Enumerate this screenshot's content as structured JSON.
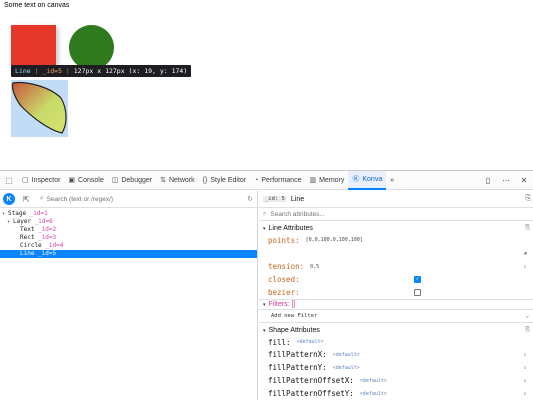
{
  "canvas": {
    "text": "Some text on canvas",
    "tooltip": {
      "name": "Line",
      "separator": "|",
      "id": "_id=5",
      "info": "127px x 127px (x: 19, y: 174)"
    }
  },
  "toolbar": {
    "tabs": [
      {
        "label": "Inspector",
        "icon": "inspector-icon"
      },
      {
        "label": "Console",
        "icon": "console-icon"
      },
      {
        "label": "Debugger",
        "icon": "debugger-icon"
      },
      {
        "label": "Network",
        "icon": "network-icon"
      },
      {
        "label": "Style Editor",
        "icon": "style-editor-icon"
      },
      {
        "label": "Performance",
        "icon": "performance-icon"
      },
      {
        "label": "Memory",
        "icon": "memory-icon"
      },
      {
        "label": "Konva",
        "icon": "konva-icon"
      }
    ],
    "active_tab": "Konva",
    "overflow": "»",
    "accent": "#0a84ff"
  },
  "tree": {
    "logo": "K",
    "search_placeholder": "Search (text or /regex/)",
    "nodes": [
      {
        "name": "Stage",
        "id": "_id=1",
        "depth": 0,
        "arrow": "▾"
      },
      {
        "name": "Layer",
        "id": "_id=6",
        "depth": 1,
        "arrow": "▾"
      },
      {
        "name": "Text",
        "id": "_id=2",
        "depth": 2,
        "arrow": ""
      },
      {
        "name": "Rect",
        "id": "_id=3",
        "depth": 2,
        "arrow": ""
      },
      {
        "name": "Circle",
        "id": "_id=4",
        "depth": 2,
        "arrow": ""
      },
      {
        "name": "Line",
        "id": "_id=5",
        "depth": 2,
        "arrow": ""
      }
    ],
    "selected": "Line"
  },
  "attributes": {
    "node_badge": "_id: 5",
    "node_name": "Line",
    "search_placeholder": "Search attributes...",
    "line_section": "Line Attributes",
    "points_name": "points:",
    "points_value": "[0,0,100,0,100,100]",
    "tension_name": "tension:",
    "tension_value": "0.5",
    "closed_name": "closed:",
    "closed_checked": true,
    "bezier_name": "bezier:",
    "bezier_checked": false,
    "filters_section": "Filters: []",
    "add_filter": "Add new Filter",
    "shape_section": "Shape Attributes",
    "shape_rows": [
      {
        "name": "fill:",
        "value": "<default>"
      },
      {
        "name": "fillPatternX:",
        "value": "<default>"
      },
      {
        "name": "fillPatternY:",
        "value": "<default>"
      },
      {
        "name": "fillPatternOffsetX:",
        "value": "<default>"
      },
      {
        "name": "fillPatternOffsetY:",
        "value": "<default>"
      }
    ]
  },
  "colors": {
    "rect": "#e5372a",
    "circle": "#2f7a1d",
    "selection": "#0a84ff",
    "id_pink": "#d63c9b"
  }
}
